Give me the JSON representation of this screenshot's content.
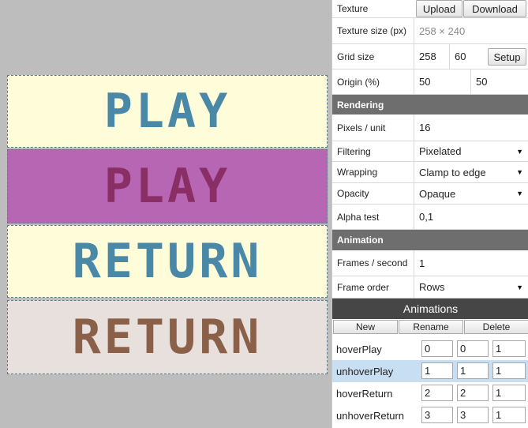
{
  "frames": [
    {
      "text": "PLAY",
      "bg": "#fffcda",
      "fg": "#4a88a8"
    },
    {
      "text": "PLAY",
      "bg": "#b666b2",
      "fg": "#8a2e66"
    },
    {
      "text": "RETURN",
      "bg": "#fffcda",
      "fg": "#4a88a8"
    },
    {
      "text": "RETURN",
      "bg": "#e8e0dc",
      "fg": "#8a6048"
    }
  ],
  "texture": {
    "label": "Texture",
    "upload_label": "Upload",
    "download_label": "Download",
    "size_label": "Texture size (px)",
    "size_value": "258 × 240",
    "grid_label": "Grid size",
    "grid_w": "258",
    "grid_h": "60",
    "setup_label": "Setup",
    "origin_label": "Origin (%)",
    "origin_x": "50",
    "origin_y": "50"
  },
  "rendering": {
    "title": "Rendering",
    "ppu_label": "Pixels / unit",
    "ppu_value": "16",
    "filtering_label": "Filtering",
    "filtering_value": "Pixelated",
    "wrapping_label": "Wrapping",
    "wrapping_value": "Clamp to edge",
    "opacity_label": "Opacity",
    "opacity_value": "Opaque",
    "alpha_label": "Alpha test",
    "alpha_value": "0,1"
  },
  "animation": {
    "title": "Animation",
    "fps_label": "Frames / second",
    "fps_value": "1",
    "order_label": "Frame order",
    "order_value": "Rows"
  },
  "animations": {
    "title": "Animations",
    "new_label": "New",
    "rename_label": "Rename",
    "delete_label": "Delete",
    "items": [
      {
        "name": "hoverPlay",
        "a": "0",
        "b": "0",
        "c": "1",
        "selected": false
      },
      {
        "name": "unhoverPlay",
        "a": "1",
        "b": "1",
        "c": "1",
        "selected": true
      },
      {
        "name": "hoverReturn",
        "a": "2",
        "b": "2",
        "c": "1",
        "selected": false
      },
      {
        "name": "unhoverReturn",
        "a": "3",
        "b": "3",
        "c": "1",
        "selected": false
      }
    ]
  },
  "icons": {
    "dropdown": "caret-down-icon"
  }
}
